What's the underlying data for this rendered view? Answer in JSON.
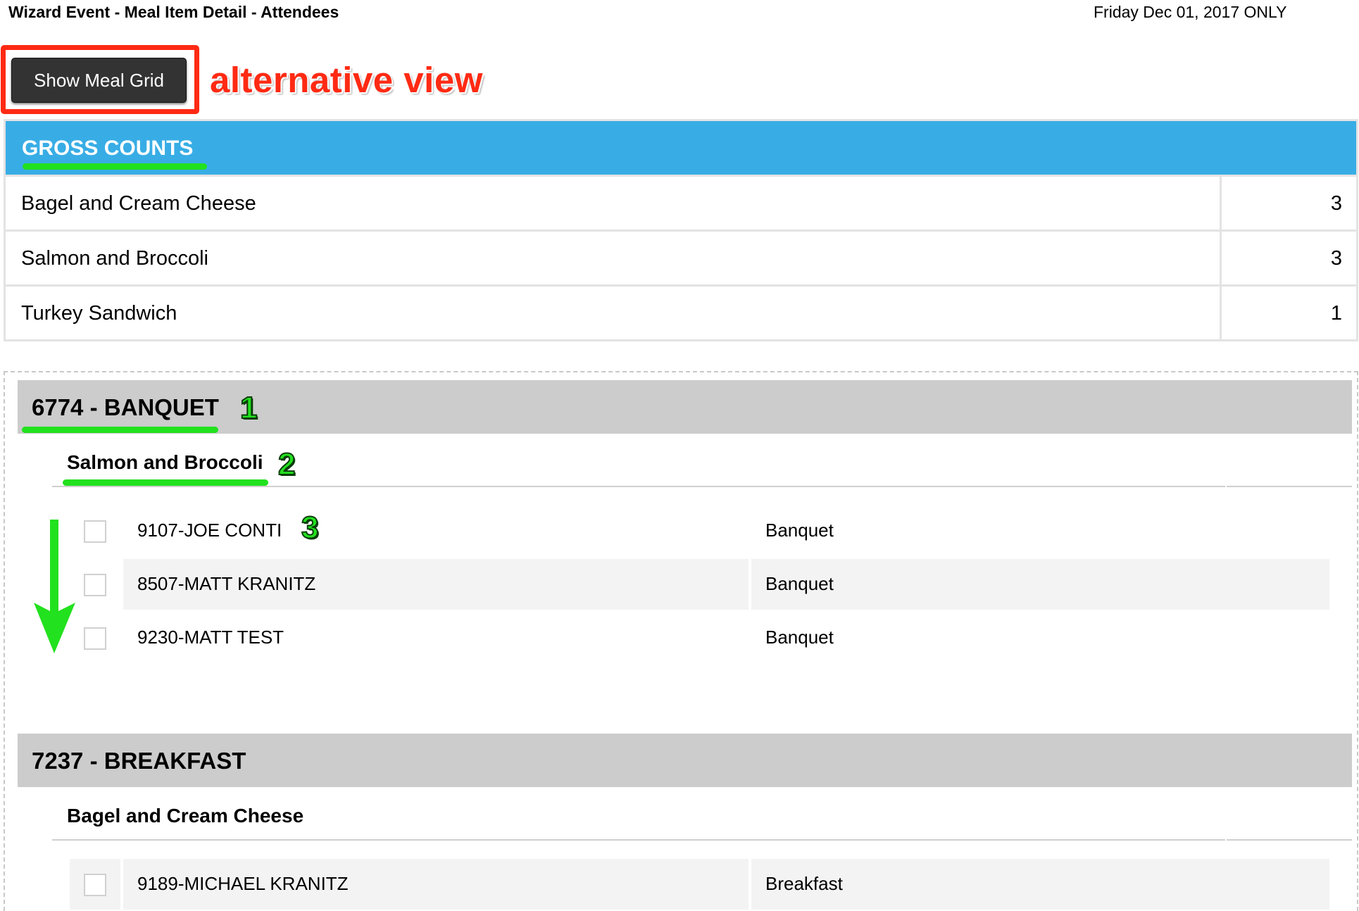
{
  "header": {
    "title": "Wizard Event - Meal Item Detail - Attendees",
    "date": "Friday Dec 01, 2017 ONLY"
  },
  "toolbar": {
    "meal_grid_label": "Show Meal Grid",
    "annotation": "alternative view"
  },
  "gross_counts": {
    "title": "GROSS COUNTS",
    "rows": [
      {
        "name": "Bagel and Cream Cheese",
        "count": "3"
      },
      {
        "name": "Salmon and Broccoli",
        "count": "3"
      },
      {
        "name": "Turkey Sandwich",
        "count": "1"
      }
    ]
  },
  "groups": [
    {
      "title": "6774 - BANQUET",
      "badge": "1",
      "meal": "Salmon and Broccoli",
      "meal_badge": "2",
      "attendees": [
        {
          "name": "9107-JOE CONTI",
          "meal": "Banquet",
          "badge": "3"
        },
        {
          "name": "8507-MATT KRANITZ",
          "meal": "Banquet"
        },
        {
          "name": "9230-MATT TEST",
          "meal": "Banquet"
        }
      ]
    },
    {
      "title": "7237 - BREAKFAST",
      "meal": "Bagel and Cream Cheese",
      "attendees": [
        {
          "name": "9189-MICHAEL KRANITZ",
          "meal": "Breakfast"
        }
      ]
    }
  ],
  "colors": {
    "accent_blue": "#38ade5",
    "highlight_red": "#ff2a13",
    "annotation_green": "#22e11e",
    "group_header_gray": "#cccccc"
  }
}
